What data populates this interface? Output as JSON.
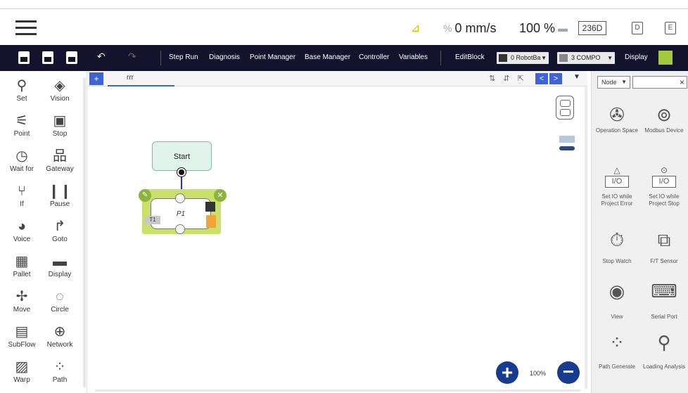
{
  "topbar": {
    "speed_value": "0 mm/s",
    "speed_prefix": "%",
    "percent": "100 %",
    "mode_box": "236D",
    "icon_right1": "D",
    "icon_right2": "E"
  },
  "toolbar": {
    "items": [
      "Step Run",
      "Diagnosis",
      "Point Manager",
      "Base Manager",
      "Controller",
      "Variables"
    ],
    "editblock": "EditBlock",
    "base_select": "0 RobotBa",
    "tool_select": "3 COMPO",
    "display": "Display"
  },
  "palette": [
    {
      "label": "Set",
      "icon": "set-icon",
      "glyph": "⚲"
    },
    {
      "label": "Vision",
      "icon": "vision-icon",
      "glyph": "◈"
    },
    {
      "label": "Point",
      "icon": "point-icon",
      "glyph": "⚟"
    },
    {
      "label": "Stop",
      "icon": "stop-icon",
      "glyph": "▣"
    },
    {
      "label": "Wait for",
      "icon": "wait-icon",
      "glyph": "◷"
    },
    {
      "label": "Gateway",
      "icon": "gateway-icon",
      "glyph": "品"
    },
    {
      "label": "If",
      "icon": "if-icon",
      "glyph": "⑂"
    },
    {
      "label": "Pause",
      "icon": "pause-icon",
      "glyph": "❙❙"
    },
    {
      "label": "Voice",
      "icon": "voice-icon",
      "glyph": "◕"
    },
    {
      "label": "Goto",
      "icon": "goto-icon",
      "glyph": "↱"
    },
    {
      "label": "Pallet",
      "icon": "pallet-icon",
      "glyph": "▦"
    },
    {
      "label": "Display",
      "icon": "display-icon",
      "glyph": "▬"
    },
    {
      "label": "Move",
      "icon": "move-icon",
      "glyph": "✢"
    },
    {
      "label": "Circle",
      "icon": "circle-icon",
      "glyph": "◌"
    },
    {
      "label": "SubFlow",
      "icon": "subflow-icon",
      "glyph": "▤"
    },
    {
      "label": "Network",
      "icon": "network-icon",
      "glyph": "⊕"
    },
    {
      "label": "Warp",
      "icon": "warp-icon",
      "glyph": "▨"
    },
    {
      "label": "Path",
      "icon": "path-icon",
      "glyph": "⁘"
    }
  ],
  "canvas": {
    "add_tab": "+",
    "tab_name": "rrr",
    "tab_tools": "⇅ ⇵ ⇱",
    "nav_prev": "<",
    "nav_next": ">",
    "tab_dropdown": "▼",
    "start_label": "Start",
    "p1_label": "P1",
    "p1_badge": "T1",
    "zoom_in": "+",
    "zoom_level": "100%",
    "zoom_out": "−"
  },
  "right_panel": {
    "filter_value": "Node",
    "search_value": "×",
    "items": [
      {
        "label": "Operation Space",
        "icon": "operation-space-icon",
        "glyph": "✇"
      },
      {
        "label": "Modbus Device",
        "icon": "modbus-device-icon",
        "glyph": "⊚"
      },
      {
        "label": "Set IO while Project Error",
        "icon": "set-io-error-icon",
        "glyph": "I/O",
        "pre": "△"
      },
      {
        "label": "Set IO while Project Stop",
        "icon": "set-io-stop-icon",
        "glyph": "I/O",
        "pre": "⊙"
      },
      {
        "label": "Stop Watch",
        "icon": "stopwatch-icon",
        "glyph": "⏱"
      },
      {
        "label": "F/T Sensor",
        "icon": "ft-sensor-icon",
        "glyph": "⧉"
      },
      {
        "label": "View",
        "icon": "view-icon",
        "glyph": "◉"
      },
      {
        "label": "Serial Port",
        "icon": "serial-port-icon",
        "glyph": "⌨"
      },
      {
        "label": "Path Generate",
        "icon": "path-generate-icon",
        "glyph": "⁘"
      },
      {
        "label": "Loading Analysis",
        "icon": "loading-analysis-icon",
        "glyph": "⚲"
      }
    ]
  }
}
